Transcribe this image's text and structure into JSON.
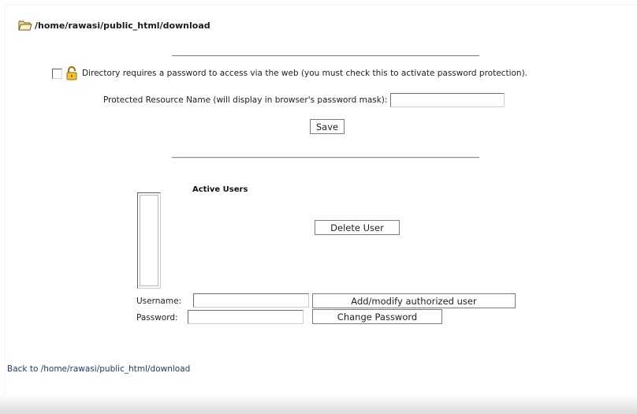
{
  "header": {
    "path": "/home/rawasi/public_html/download"
  },
  "protection": {
    "checkbox_label": "Directory requires a password to access via the web (you must check this to activate password protection).",
    "resource_label": "Protected Resource Name (will display in browser's password mask):",
    "resource_value": "",
    "save_label": "Save"
  },
  "users": {
    "title": "Active Users",
    "list_items": [],
    "delete_label": "Delete User",
    "username_label": "Username:",
    "username_value": "",
    "password_label": "Password:",
    "password_value": "",
    "add_label": "Add/modify authorized user",
    "change_password_label": "Change Password"
  },
  "footer": {
    "back_link": "Back to /home/rawasi/public_html/download"
  },
  "icons": {
    "folder": "folder-icon",
    "lock": "lock-icon"
  }
}
